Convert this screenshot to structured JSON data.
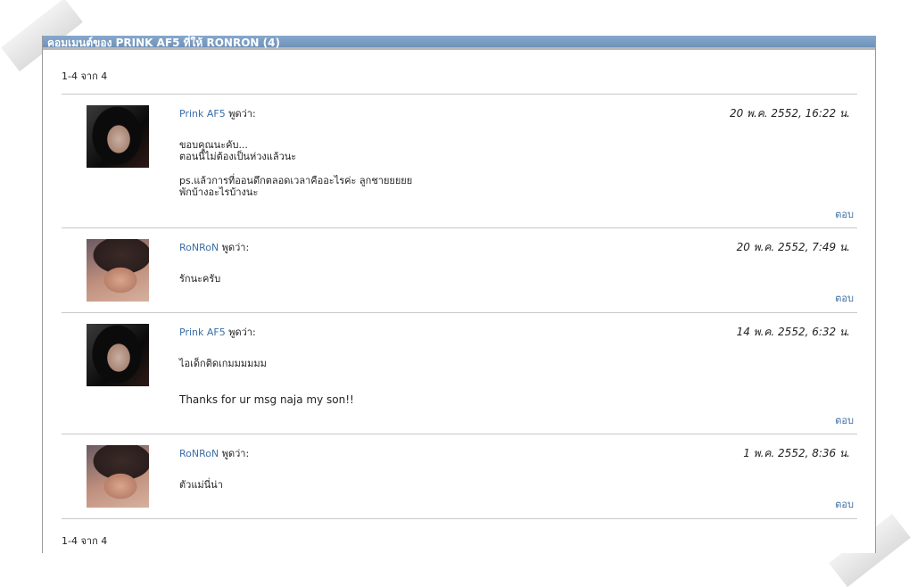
{
  "header": {
    "title": "คอมเมนต์ของ PRINK AF5 ที่ให้ RONRON (4)"
  },
  "pagination": {
    "top": "1-4 จาก 4",
    "bottom": "1-4 จาก 4"
  },
  "said_label": "พูดว่า:",
  "reply_label": "ตอบ",
  "comments": [
    {
      "author": "Prink AF5",
      "date": "20 พ.ค. 2552, 16:22 น.",
      "lines": [
        "ขอบคุณนะคับ...",
        "ตอนนี้ไม่ต้องเป็นห่วงแล้วนะ",
        "",
        "ps.แล้วการที่ออนดึกตลอดเวลาคืออะไรค่ะ ลูกชายยยยย",
        "พักบ้างอะไรบ้างนะ"
      ]
    },
    {
      "author": "RoNRoN",
      "date": "20 พ.ค. 2552, 7:49 น.",
      "lines": [
        "รักนะครับ"
      ]
    },
    {
      "author": "Prink AF5",
      "date": "14 พ.ค. 2552, 6:32 น.",
      "lines": [
        "ไอเด็กติดเกมมมมมม"
      ],
      "extra": "Thanks for ur msg naja my son!!"
    },
    {
      "author": "RoNRoN",
      "date": "1 พ.ค. 2552, 8:36 น.",
      "lines": [
        "ตัวแม่นี่น่า"
      ]
    }
  ]
}
